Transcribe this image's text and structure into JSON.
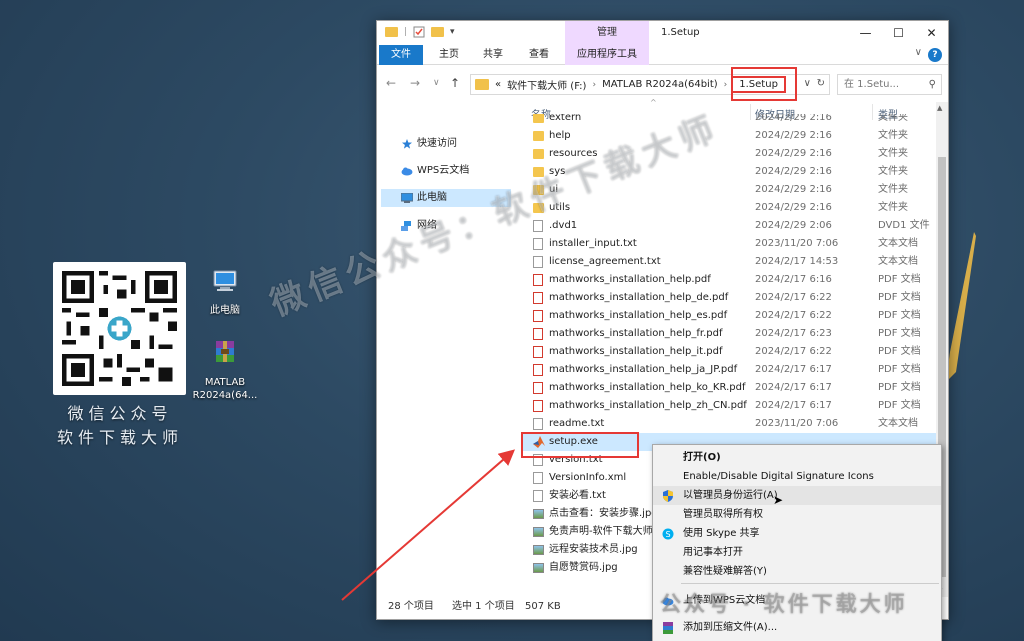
{
  "desktop": {
    "qr_caption_line1": "微信公众号",
    "qr_caption_line2": "软件下载大师",
    "icons": [
      {
        "label": "此电脑",
        "icon": "computer-icon"
      },
      {
        "label": "MATLAB R2024a(64...",
        "icon": "winrar-archive-icon"
      }
    ],
    "watermarks": [
      "微信公众号：软件下载大师",
      "公众号 · 软件下载大师"
    ]
  },
  "window": {
    "title": "1.Setup",
    "context_tab_group": "管理",
    "ribbon_tabs": [
      "文件",
      "主页",
      "共享",
      "查看",
      "应用程序工具"
    ],
    "controls": {
      "minimize": "—",
      "maximize": "☐",
      "close": "✕"
    },
    "help": "?"
  },
  "address": {
    "crumbs": [
      "«",
      "软件下载大师 (F:)",
      "MATLAB R2024a(64bit)",
      "1.Setup"
    ],
    "search_placeholder": "在 1.Setu..."
  },
  "nav_pane": [
    {
      "label": "快速访问",
      "icon": "star-icon"
    },
    {
      "label": "WPS云文档",
      "icon": "cloud-icon"
    },
    {
      "label": "此电脑",
      "icon": "computer-icon",
      "selected": true
    },
    {
      "label": "网络",
      "icon": "network-icon"
    }
  ],
  "columns": {
    "name": "名称",
    "date": "修改日期",
    "type": "类型"
  },
  "files": [
    {
      "name": "extern",
      "date": "2024/2/29 2:16",
      "type": "文件夹",
      "icon": "folder"
    },
    {
      "name": "help",
      "date": "2024/2/29 2:16",
      "type": "文件夹",
      "icon": "folder"
    },
    {
      "name": "resources",
      "date": "2024/2/29 2:16",
      "type": "文件夹",
      "icon": "folder"
    },
    {
      "name": "sys",
      "date": "2024/2/29 2:16",
      "type": "文件夹",
      "icon": "folder"
    },
    {
      "name": "ui",
      "date": "2024/2/29 2:16",
      "type": "文件夹",
      "icon": "folder"
    },
    {
      "name": "utils",
      "date": "2024/2/29 2:16",
      "type": "文件夹",
      "icon": "folder"
    },
    {
      "name": ".dvd1",
      "date": "2024/2/29 2:06",
      "type": "DVD1 文件",
      "icon": "doc"
    },
    {
      "name": "installer_input.txt",
      "date": "2023/11/20 7:06",
      "type": "文本文档",
      "icon": "doc"
    },
    {
      "name": "license_agreement.txt",
      "date": "2024/2/17 14:53",
      "type": "文本文档",
      "icon": "doc"
    },
    {
      "name": "mathworks_installation_help.pdf",
      "date": "2024/2/17 6:16",
      "type": "PDF 文档",
      "icon": "pdf"
    },
    {
      "name": "mathworks_installation_help_de.pdf",
      "date": "2024/2/17 6:22",
      "type": "PDF 文档",
      "icon": "pdf"
    },
    {
      "name": "mathworks_installation_help_es.pdf",
      "date": "2024/2/17 6:22",
      "type": "PDF 文档",
      "icon": "pdf"
    },
    {
      "name": "mathworks_installation_help_fr.pdf",
      "date": "2024/2/17 6:23",
      "type": "PDF 文档",
      "icon": "pdf"
    },
    {
      "name": "mathworks_installation_help_it.pdf",
      "date": "2024/2/17 6:22",
      "type": "PDF 文档",
      "icon": "pdf"
    },
    {
      "name": "mathworks_installation_help_ja_JP.pdf",
      "date": "2024/2/17 6:17",
      "type": "PDF 文档",
      "icon": "pdf"
    },
    {
      "name": "mathworks_installation_help_ko_KR.pdf",
      "date": "2024/2/17 6:17",
      "type": "PDF 文档",
      "icon": "pdf"
    },
    {
      "name": "mathworks_installation_help_zh_CN.pdf",
      "date": "2024/2/17 6:17",
      "type": "PDF 文档",
      "icon": "pdf"
    },
    {
      "name": "readme.txt",
      "date": "2023/11/20 7:06",
      "type": "文本文档",
      "icon": "doc"
    },
    {
      "name": "setup.exe",
      "date": "",
      "type": "",
      "icon": "exe",
      "selected": true
    },
    {
      "name": "version.txt",
      "date": "",
      "type": "",
      "icon": "doc"
    },
    {
      "name": "VersionInfo.xml",
      "date": "",
      "type": "",
      "icon": "doc"
    },
    {
      "name": "安装必看.txt",
      "date": "",
      "type": "",
      "icon": "doc"
    },
    {
      "name": "点击查看：安装步骤.jpg",
      "date": "",
      "type": "",
      "icon": "img"
    },
    {
      "name": "免责声明-软件下载大师",
      "date": "",
      "type": "",
      "icon": "img"
    },
    {
      "name": "远程安装技术员.jpg",
      "date": "",
      "type": "",
      "icon": "img"
    },
    {
      "name": "自愿赞赏码.jpg",
      "date": "",
      "type": "",
      "icon": "img"
    }
  ],
  "status": {
    "count": "28 个项目",
    "selected": "选中 1 个项目",
    "size": "507 KB"
  },
  "context_menu": [
    {
      "label": "打开(O)",
      "bold": true,
      "icon": ""
    },
    {
      "label": "Enable/Disable Digital Signature Icons",
      "icon": ""
    },
    {
      "label": "以管理员身份运行(A)",
      "icon": "uac-shield-icon",
      "highlight": true
    },
    {
      "label": "管理员取得所有权",
      "icon": ""
    },
    {
      "label": "使用 Skype 共享",
      "icon": "skype-icon"
    },
    {
      "label": "用记事本打开",
      "icon": ""
    },
    {
      "label": "兼容性疑难解答(Y)",
      "icon": ""
    },
    {
      "label": "上传到WPS云文档",
      "icon": "wps-cloud-icon"
    },
    {
      "label": "添加到压缩文件(A)...",
      "icon": "winrar-icon"
    }
  ],
  "colors": {
    "accent": "#1979ca",
    "selection": "#cce8ff",
    "context_tab": "#efd9ff",
    "annotation_red": "#e53935"
  }
}
